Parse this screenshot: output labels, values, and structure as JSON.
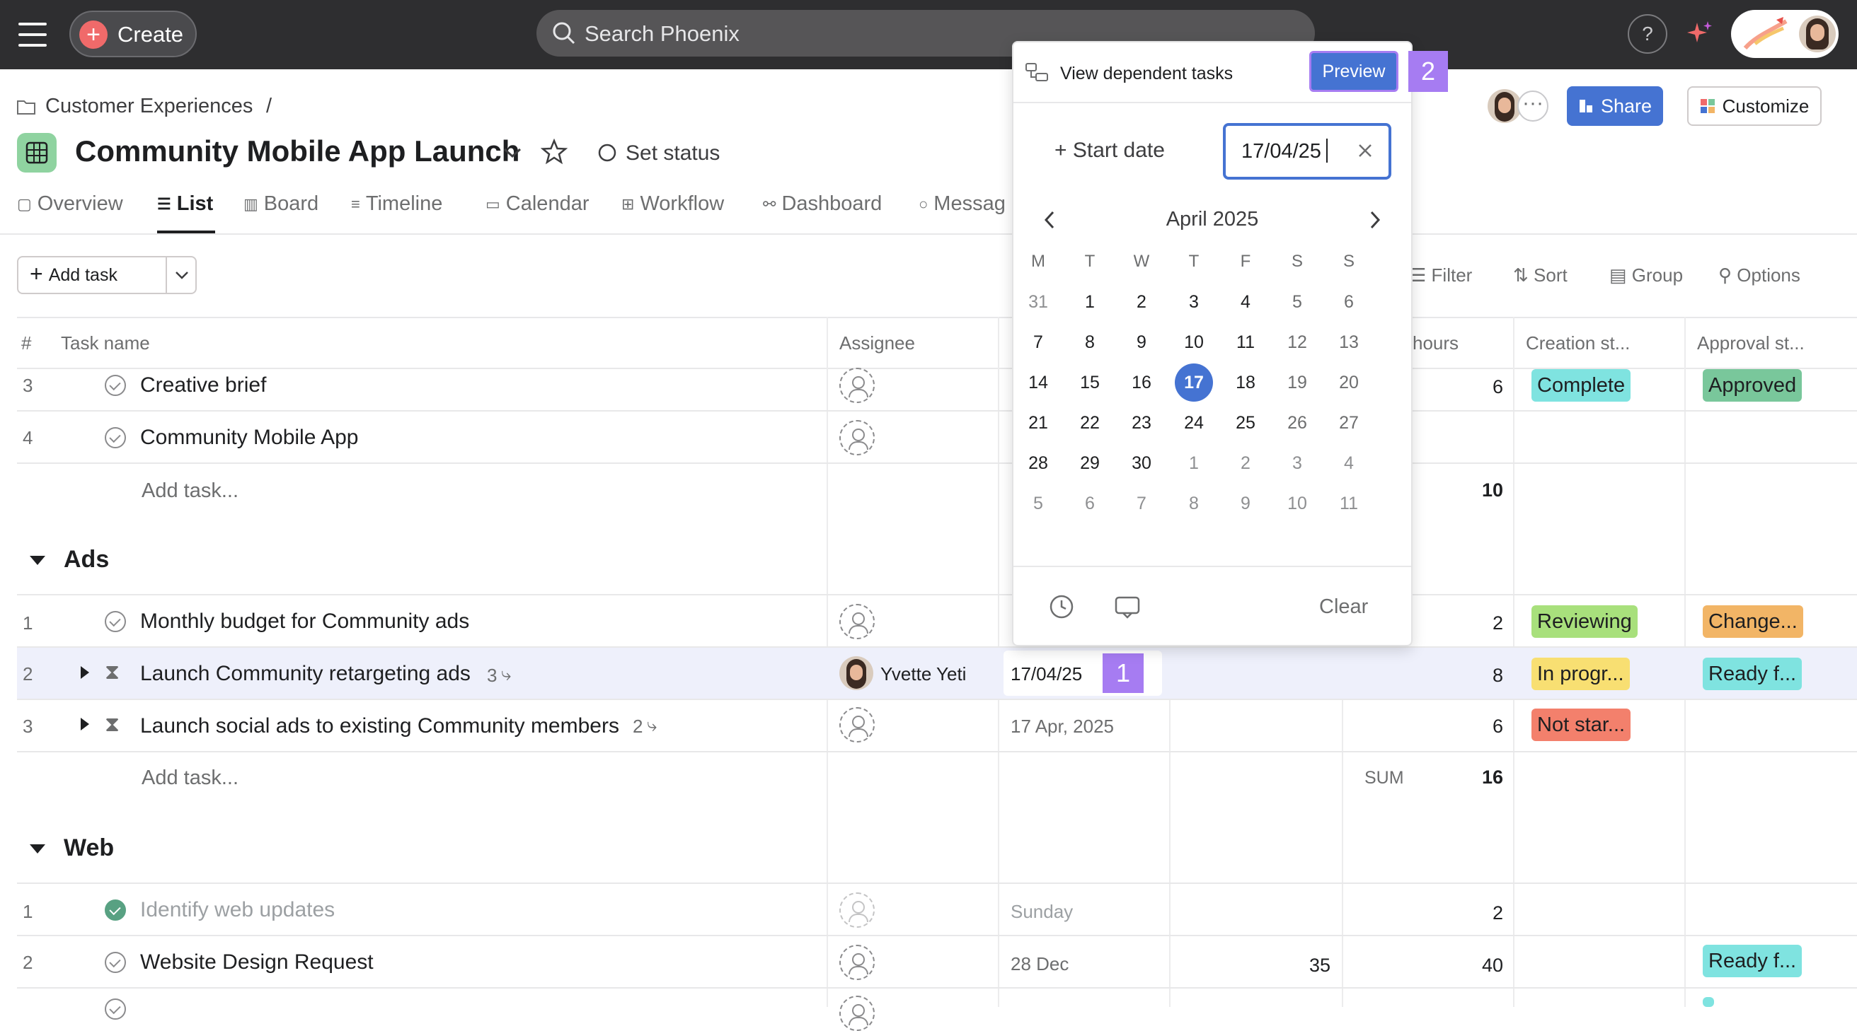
{
  "topbar": {
    "create_label": "Create",
    "search_placeholder": "Search Phoenix",
    "help_label": "?"
  },
  "header": {
    "breadcrumb": "Customer Experiences",
    "breadcrumb_sep": "/",
    "title": "Community Mobile App Launch",
    "set_status": "Set status",
    "share": "Share",
    "customize": "Customize"
  },
  "tabs": [
    "Overview",
    "List",
    "Board",
    "Timeline",
    "Calendar",
    "Workflow",
    "Dashboard",
    "Messag"
  ],
  "toolbar": {
    "add_task": "Add task",
    "filter": "Filter",
    "sort": "Sort",
    "group": "Group",
    "options": "Options"
  },
  "columns": {
    "num": "#",
    "task_name": "Task name",
    "assignee": "Assignee",
    "hours": "hours",
    "creation": "Creation st...",
    "approval": "Approval st..."
  },
  "section1": {
    "rows": [
      {
        "num": "3",
        "name": "Creative brief",
        "hours": "6",
        "creation": "Complete",
        "approval": "Approved"
      },
      {
        "num": "4",
        "name": "Community Mobile App"
      }
    ],
    "add_task": "Add task...",
    "sum": "10"
  },
  "section_ads": {
    "title": "Ads",
    "rows": [
      {
        "num": "1",
        "name": "Monthly budget for Community ads",
        "hours": "2",
        "creation": "Reviewing",
        "approval": "Change..."
      },
      {
        "num": "2",
        "name": "Launch Community retargeting ads",
        "subtasks": "3",
        "assignee": "Yvette Yeti",
        "date": "17/04/25",
        "hours": "8",
        "creation": "In progr...",
        "approval": "Ready f..."
      },
      {
        "num": "3",
        "name": "Launch social ads to existing Community members",
        "subtasks": "2",
        "date": "17 Apr, 2025",
        "hours": "6",
        "creation": "Not star..."
      }
    ],
    "add_task": "Add task...",
    "sum_label": "SUM",
    "sum": "16"
  },
  "section_web": {
    "title": "Web",
    "rows": [
      {
        "num": "1",
        "name": "Identify web updates",
        "date": "Sunday",
        "hours": "2"
      },
      {
        "num": "2",
        "name": "Website Design Request",
        "date": "28 Dec",
        "est": "35",
        "hours": "40",
        "approval": "Ready f..."
      }
    ]
  },
  "popover": {
    "view_dependent": "View dependent tasks",
    "preview": "Preview",
    "start_date": "+ Start date",
    "date_value": "17/04/25",
    "month": "April 2025",
    "weekdays": [
      "M",
      "T",
      "W",
      "T",
      "F",
      "S",
      "S"
    ],
    "weeks": [
      [
        "31",
        "1",
        "2",
        "3",
        "4",
        "5",
        "6"
      ],
      [
        "7",
        "8",
        "9",
        "10",
        "11",
        "12",
        "13"
      ],
      [
        "14",
        "15",
        "16",
        "17",
        "18",
        "19",
        "20"
      ],
      [
        "21",
        "22",
        "23",
        "24",
        "25",
        "26",
        "27"
      ],
      [
        "28",
        "29",
        "30",
        "1",
        "2",
        "3",
        "4"
      ],
      [
        "5",
        "6",
        "7",
        "8",
        "9",
        "10",
        "11"
      ]
    ],
    "selected": "17",
    "clear": "Clear"
  },
  "markers": {
    "m1": "1",
    "m2": "2"
  },
  "colors": {
    "topbar": "#2e2e30",
    "accent": "#4573d2",
    "complete": "#7fe3e0",
    "approved": "#79c79b",
    "reviewing": "#a8e07c",
    "change": "#f2b566",
    "in_progress": "#f8df72",
    "ready": "#7fe3e0",
    "not_started": "#f3806c",
    "marker": "#a67cf2"
  }
}
